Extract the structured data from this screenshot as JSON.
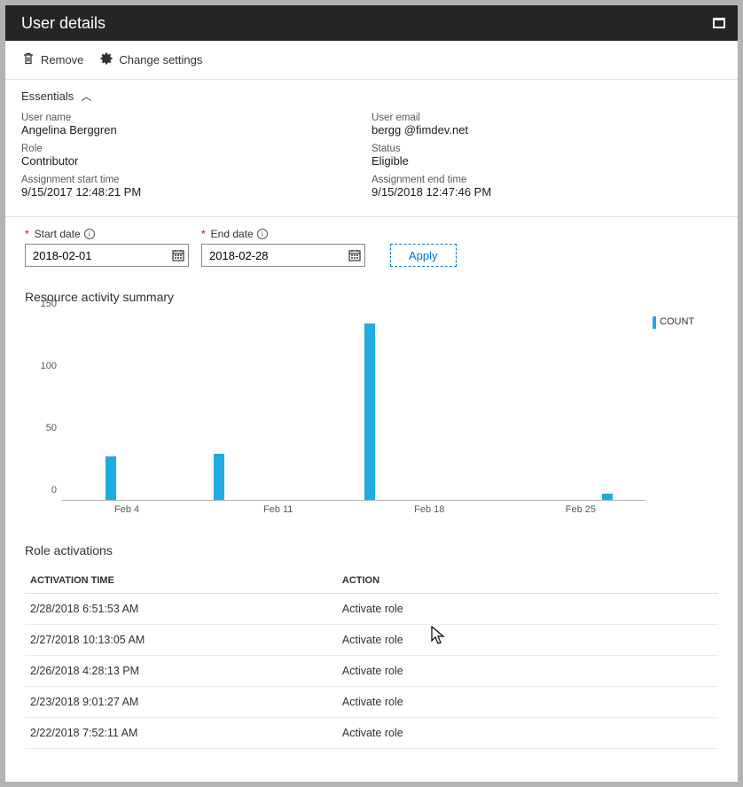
{
  "window": {
    "title": "User details"
  },
  "toolbar": {
    "remove_label": "Remove",
    "settings_label": "Change settings"
  },
  "essentials": {
    "header": "Essentials",
    "left": {
      "username_lbl": "User name",
      "username_val": "Angelina Berggren",
      "role_lbl": "Role",
      "role_val": "Contributor",
      "start_lbl": "Assignment start time",
      "start_val": "9/15/2017 12:48:21 PM"
    },
    "right": {
      "email_lbl": "User email",
      "email_val": "bergg @fimdev.net",
      "status_lbl": "Status",
      "status_val": "Eligible",
      "end_lbl": "Assignment end time",
      "end_val": "9/15/2018 12:47:46 PM"
    }
  },
  "filters": {
    "start_lbl": "Start date",
    "start_val": "2018-02-01",
    "end_lbl": "End date",
    "end_val": "2018-02-28",
    "apply_label": "Apply"
  },
  "summary_title": "Resource activity summary",
  "legend_label": "COUNT",
  "chart_data": {
    "type": "bar",
    "title": "Resource activity summary",
    "xlabel": "",
    "ylabel": "",
    "ylim": [
      0,
      150
    ],
    "yticks": [
      0,
      50,
      100,
      150
    ],
    "xticks": [
      "Feb 4",
      "Feb 11",
      "Feb 18",
      "Feb 25"
    ],
    "xrange_days": [
      "2018-02-01",
      "2018-02-28"
    ],
    "series": [
      {
        "name": "COUNT",
        "points": [
          {
            "x_day": 3,
            "value": 35
          },
          {
            "x_day": 8,
            "value": 37
          },
          {
            "x_day": 15,
            "value": 143
          },
          {
            "x_day": 26,
            "value": 5
          }
        ]
      }
    ]
  },
  "role_activations": {
    "title": "Role activations",
    "col_time": "ACTIVATION TIME",
    "col_action": "ACTION",
    "rows": [
      {
        "time": "2/28/2018 6:51:53 AM",
        "action": "Activate role"
      },
      {
        "time": "2/27/2018 10:13:05 AM",
        "action": "Activate role"
      },
      {
        "time": "2/26/2018 4:28:13 PM",
        "action": "Activate role"
      },
      {
        "time": "2/23/2018 9:01:27 AM",
        "action": "Activate role"
      },
      {
        "time": "2/22/2018 7:52:11 AM",
        "action": "Activate role"
      }
    ]
  }
}
